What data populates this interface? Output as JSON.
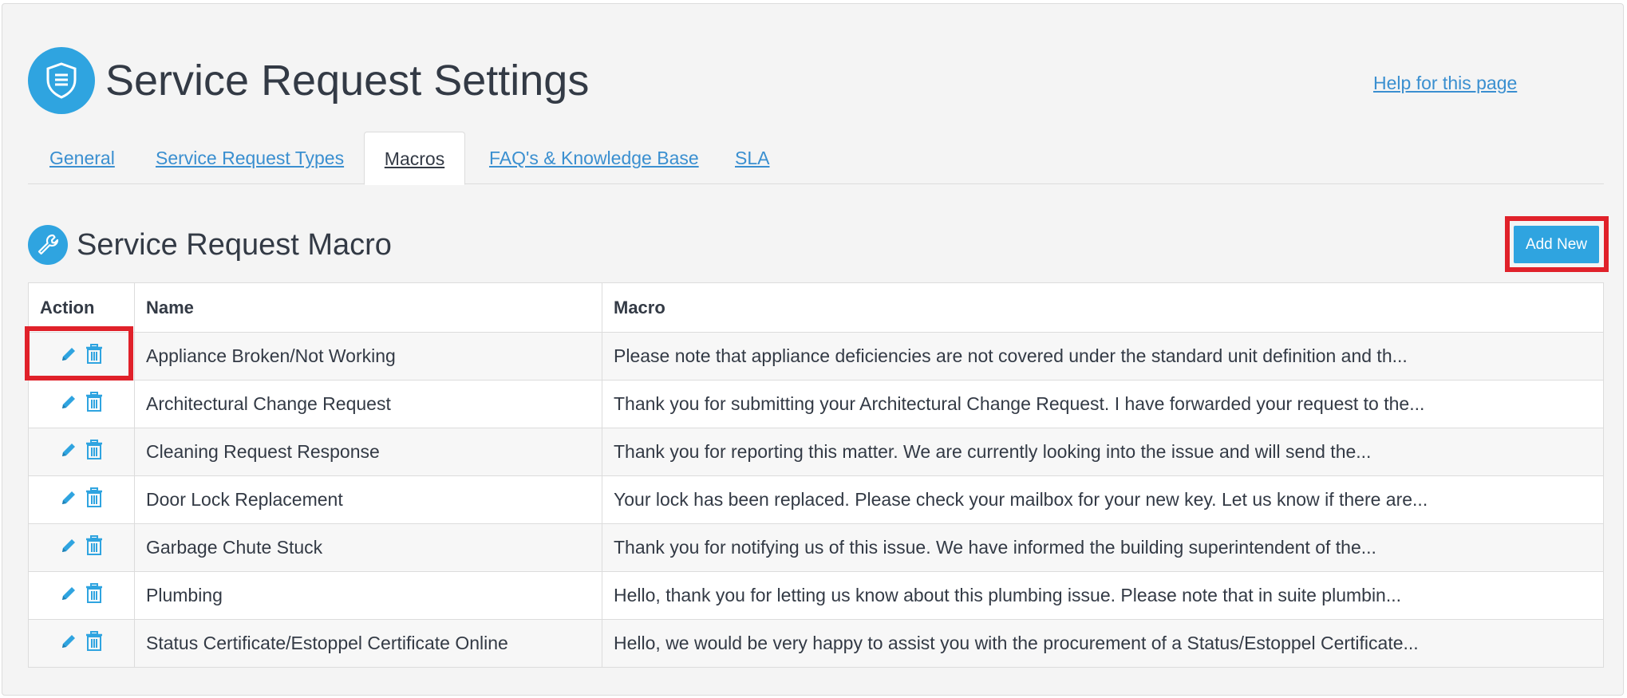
{
  "header": {
    "title": "Service Request Settings",
    "icon": "shield-document-icon",
    "help_link": "Help for this page"
  },
  "tabs": [
    {
      "label": "General",
      "active": false
    },
    {
      "label": "Service Request Types",
      "active": false
    },
    {
      "label": "Macros",
      "active": true
    },
    {
      "label": "FAQ's & Knowledge Base",
      "active": false
    },
    {
      "label": "SLA",
      "active": false
    }
  ],
  "section": {
    "title": "Service Request Macro",
    "icon": "wrench-icon",
    "add_button": "Add New"
  },
  "table": {
    "columns": [
      "Action",
      "Name",
      "Macro"
    ],
    "rows": [
      {
        "name": "Appliance Broken/Not Working",
        "macro": "Please note that appliance deficiencies are not covered under the standard unit definition and th..."
      },
      {
        "name": "Architectural Change Request",
        "macro": "Thank you for submitting your Architectural Change Request. I have forwarded your request to the..."
      },
      {
        "name": "Cleaning Request Response",
        "macro": "Thank you for reporting this matter. We are currently looking into the issue and will send the..."
      },
      {
        "name": "Door Lock Replacement",
        "macro": "Your lock has been replaced. Please check your mailbox for your new key. Let us know if there are..."
      },
      {
        "name": "Garbage Chute Stuck",
        "macro": "Thank you for notifying us of this issue. We have informed the building superintendent of the..."
      },
      {
        "name": "Plumbing",
        "macro": "Hello, thank you for letting us know about this plumbing issue. Please note that in suite plumbin..."
      },
      {
        "name": "Status Certificate/Estoppel Certificate Online",
        "macro": "Hello, we would be very happy to assist you with the procurement of a Status/Estoppel Certificate..."
      }
    ],
    "row_actions": [
      "pencil-icon",
      "trash-icon"
    ]
  },
  "colors": {
    "accent": "#2fa4e0",
    "link": "#3a8fd0",
    "highlight": "#e0212a",
    "text": "#333a45"
  }
}
